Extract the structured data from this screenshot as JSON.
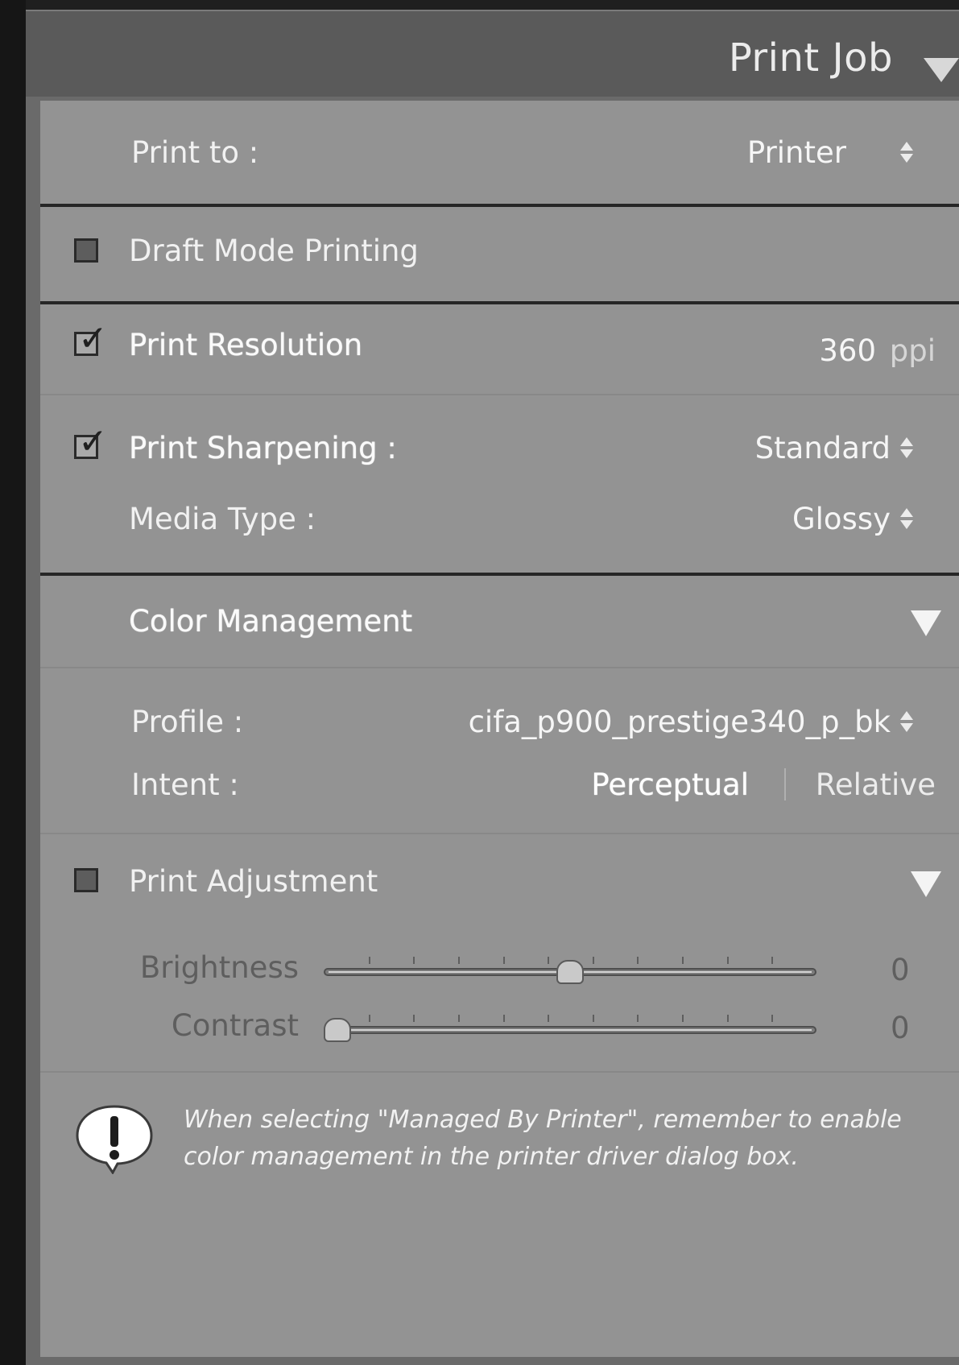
{
  "header": {
    "title": "Print Job"
  },
  "print_to": {
    "label": "Print to :",
    "value": "Printer"
  },
  "draft_mode": {
    "label": "Draft Mode Printing",
    "checked": false
  },
  "resolution": {
    "label": "Print Resolution",
    "checked": true,
    "value": "360",
    "unit": "ppi"
  },
  "sharpening": {
    "label": "Print Sharpening :",
    "checked": true,
    "value": "Standard"
  },
  "media_type": {
    "label": "Media Type :",
    "value": "Glossy"
  },
  "color_management": {
    "title": "Color Management",
    "profile_label": "Profile :",
    "profile_value": "cifa_p900_prestige340_p_bk",
    "intent_label": "Intent :",
    "intent_options": [
      "Perceptual",
      "Relative"
    ],
    "intent_selected": "Perceptual"
  },
  "print_adjustment": {
    "label": "Print Adjustment",
    "checked": false,
    "sliders": [
      {
        "label": "Brightness",
        "value": "0",
        "level": 0.5
      },
      {
        "label": "Contrast",
        "value": "0",
        "level": 0.0
      }
    ]
  },
  "notice": {
    "text": "When selecting \"Managed By Printer\", remember to enable color management in the printer driver dialog box."
  },
  "colors": {
    "panel_bg": "#939393",
    "header_bg": "#5a5a5a",
    "text": "#f1f1f1",
    "disabled_text": "#5e5e5e"
  }
}
